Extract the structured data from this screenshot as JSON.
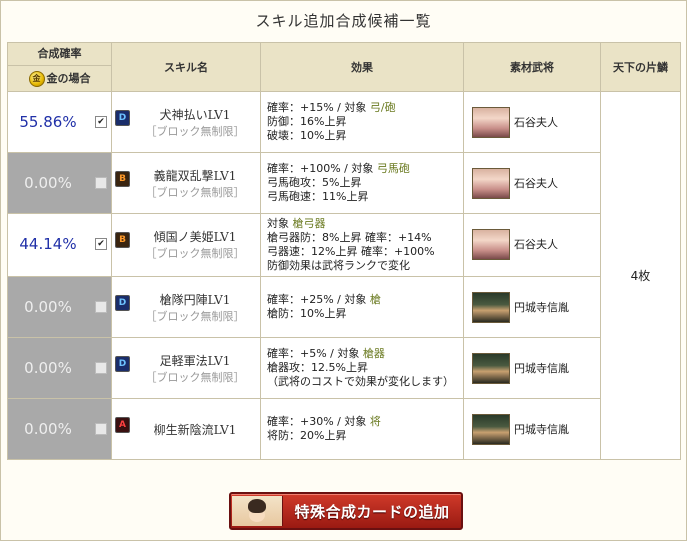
{
  "title": "スキル追加合成候補一覧",
  "headers": {
    "rate": "合成確率",
    "gold": "金の場合",
    "gold_icon_text": "金",
    "skill": "スキル名",
    "effect": "効果",
    "material": "素材武将",
    "tenka": "天下の片鱗"
  },
  "tenka_value": "4枚",
  "rows": [
    {
      "rate": "55.86%",
      "checked": true,
      "badge": "D",
      "skill": "犬神払いLV1",
      "block": "［ブロック無制限］",
      "effects": [
        [
          "確率：+15% / 対象 ",
          "弓/砲"
        ],
        [
          "防御：16%上昇",
          ""
        ],
        [
          "破壊：10%上昇",
          ""
        ]
      ],
      "material": "石谷夫人"
    },
    {
      "rate": "0.00%",
      "checked": false,
      "badge": "B",
      "skill": "義龍双乱撃LV1",
      "block": "［ブロック無制限］",
      "effects": [
        [
          "確率：+100% / 対象 ",
          "弓馬砲"
        ],
        [
          "弓馬砲攻：5%上昇",
          ""
        ],
        [
          "弓馬砲速：11%上昇",
          ""
        ]
      ],
      "material": "石谷夫人"
    },
    {
      "rate": "44.14%",
      "checked": true,
      "badge": "B",
      "skill": "傾国ノ美姫LV1",
      "block": "［ブロック無制限］",
      "effects": [
        [
          "対象 ",
          "槍弓器"
        ],
        [
          "槍弓器防：8%上昇 確率：+14%",
          ""
        ],
        [
          "弓器速：12%上昇 確率：+100%",
          ""
        ],
        [
          "防御効果は武将ランクで変化",
          ""
        ]
      ],
      "material": "石谷夫人"
    },
    {
      "rate": "0.00%",
      "checked": false,
      "badge": "D",
      "skill": "槍隊円陣LV1",
      "block": "［ブロック無制限］",
      "effects": [
        [
          "確率：+25% / 対象 ",
          "槍"
        ],
        [
          "槍防：10%上昇",
          ""
        ]
      ],
      "material": "円城寺信胤"
    },
    {
      "rate": "0.00%",
      "checked": false,
      "badge": "D",
      "skill": "足軽軍法LV1",
      "block": "［ブロック無制限］",
      "effects": [
        [
          "確率：+5% / 対象 ",
          "槍器"
        ],
        [
          "槍器攻：12.5%上昇",
          ""
        ],
        [
          "（武将のコストで効果が変化します）",
          ""
        ]
      ],
      "material": "円城寺信胤"
    },
    {
      "rate": "0.00%",
      "checked": false,
      "badge": "A",
      "skill": "柳生新陰流LV1",
      "block": "",
      "effects": [
        [
          "確率：+30% / 対象 ",
          "将"
        ],
        [
          "将防：20%上昇",
          ""
        ]
      ],
      "material": "円城寺信胤"
    }
  ],
  "button": {
    "label": "特殊合成カードの追加"
  },
  "colors": {
    "rate_on": "#2030a8",
    "rate_off_bg": "#a9a9a9",
    "header_bg": "#eae3c6",
    "button": "#b8281c"
  },
  "icons": {
    "rank_badge": "rank-badge-icon",
    "portrait": "general-portrait-icon",
    "checkbox": "checkbox-icon"
  }
}
